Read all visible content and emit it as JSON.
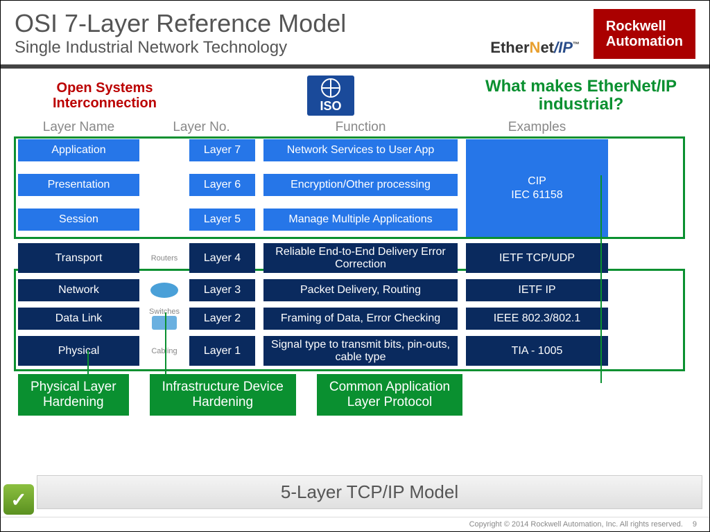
{
  "header": {
    "title": "OSI 7-Layer Reference Model",
    "subtitle": "Single Industrial Network Technology",
    "ethernet_logo": {
      "ether": "Ether",
      "n": "N",
      "et": "et",
      "ip": "/IP"
    },
    "ra_line1": "Rockwell",
    "ra_line2": "Automation"
  },
  "top": {
    "osi_l1": "Open Systems",
    "osi_l2": "Interconnection",
    "iso": "ISO",
    "q_l1": "What makes EtherNet/IP",
    "q_l2": "industrial?"
  },
  "columns": {
    "c1": "Layer Name",
    "c2": "Layer No.",
    "c3": "Function",
    "c4": "Examples"
  },
  "mid_labels": {
    "routers": "Routers",
    "switches": "Switches",
    "cabling": "Cabling"
  },
  "rows": [
    {
      "name": "Application",
      "num": "Layer 7",
      "func": "Network Services to User App",
      "ex_l1": "CIP",
      "ex_l2": "IEC 61158",
      "group": "top",
      "blue": true
    },
    {
      "name": "Presentation",
      "num": "Layer 6",
      "func": "Encryption/Other processing",
      "group": "top",
      "blue": true
    },
    {
      "name": "Session",
      "num": "Layer 5",
      "func": "Manage Multiple Applications",
      "group": "top",
      "blue": true
    },
    {
      "name": "Transport",
      "num": "Layer 4",
      "func": "Reliable End-to-End Delivery Error Correction",
      "ex": "IETF TCP/UDP",
      "group": "mid"
    },
    {
      "name": "Network",
      "num": "Layer 3",
      "func": "Packet Delivery, Routing",
      "ex": "IETF IP",
      "group": "bottom",
      "mid": "routers"
    },
    {
      "name": "Data Link",
      "num": "Layer 2",
      "func": "Framing of Data, Error Checking",
      "ex": "IEEE 802.3/802.1",
      "group": "bottom",
      "mid": "switches"
    },
    {
      "name": "Physical",
      "num": "Layer 1",
      "func": "Signal type to transmit bits, pin-outs, cable type",
      "ex": "TIA - 1005",
      "group": "bottom",
      "mid": "cabling"
    }
  ],
  "tags": {
    "t1_l1": "Physical Layer",
    "t1_l2": "Hardening",
    "t2_l1": "Infrastructure Device",
    "t2_l2": "Hardening",
    "t3_l1": "Common Application",
    "t3_l2": "Layer Protocol"
  },
  "footer": "5-Layer TCP/IP Model",
  "copyright": "Copyright © 2014 Rockwell Automation, Inc. All rights reserved.",
  "page": "9"
}
